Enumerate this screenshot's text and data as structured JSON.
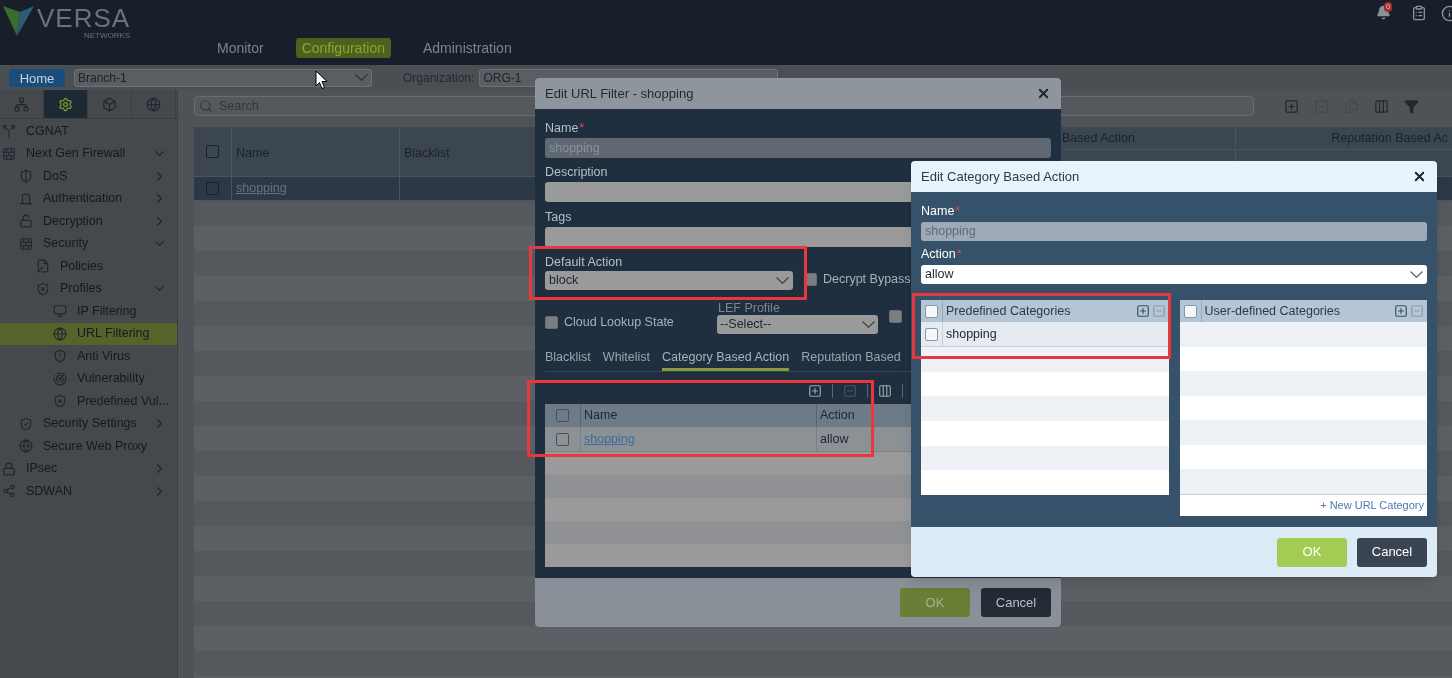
{
  "header": {
    "logo": {
      "name": "VERSA",
      "tagline": "NETWORKS"
    },
    "nav": [
      {
        "label": "Monitor",
        "selected": false
      },
      {
        "label": "Configuration",
        "selected": true
      },
      {
        "label": "Administration",
        "selected": false
      }
    ],
    "notifications": {
      "count": "0"
    }
  },
  "context_bar": {
    "home": "Home",
    "appliance": {
      "value": "Branch-1"
    },
    "organization": {
      "label": "Organization:",
      "value": "ORG-1"
    }
  },
  "sidebar": {
    "tabs": [
      {
        "kind": "network",
        "selected": false
      },
      {
        "kind": "gear",
        "selected": true
      },
      {
        "kind": "cube",
        "selected": false
      },
      {
        "kind": "globe",
        "selected": false
      }
    ],
    "items": [
      {
        "label": "CGNAT",
        "kind": "nat",
        "selected": false
      },
      {
        "label": "Next Gen Firewall",
        "kind": "firewall",
        "selected": false,
        "expanded": true,
        "children": [
          {
            "label": "DoS",
            "kind": "shield",
            "selected": false,
            "expanded": false
          },
          {
            "label": "Authentication",
            "kind": "door",
            "selected": false,
            "expanded": false
          },
          {
            "label": "Decryption",
            "kind": "unlock",
            "selected": false,
            "expanded": false
          },
          {
            "label": "Security",
            "kind": "wall",
            "selected": false,
            "expanded": true,
            "children": [
              {
                "label": "Policies",
                "kind": "doc",
                "selected": false
              },
              {
                "label": "Profiles",
                "kind": "shield-x",
                "selected": false,
                "expanded": true,
                "children": [
                  {
                    "label": "IP Filtering",
                    "kind": "monitor",
                    "selected": false
                  },
                  {
                    "label": "URL Filtering",
                    "kind": "globe",
                    "selected": true
                  },
                  {
                    "label": "Anti Virus",
                    "kind": "shield-alert",
                    "selected": false
                  },
                  {
                    "label": "Vulnerability",
                    "kind": "radar",
                    "selected": false
                  },
                  {
                    "label": "Predefined Vul...",
                    "kind": "shield-x",
                    "selected": false
                  }
                ]
              }
            ]
          },
          {
            "label": "Security Settings",
            "kind": "shield-check",
            "selected": false,
            "expanded": false
          },
          {
            "label": "Secure Web Proxy",
            "kind": "globe",
            "selected": false
          }
        ]
      },
      {
        "label": "IPsec",
        "kind": "lock",
        "selected": false,
        "expanded": false
      },
      {
        "label": "SDWAN",
        "kind": "share",
        "selected": false,
        "expanded": false
      }
    ]
  },
  "main": {
    "search": {
      "placeholder": "Search"
    },
    "table": {
      "columns": [
        "Name",
        "Blacklist"
      ],
      "groups": [
        "Based Action",
        "Reputation Based Ac"
      ],
      "select_all": {
        "checked": false
      },
      "rows": [
        {
          "name": "shopping",
          "selected": true,
          "checked": false
        }
      ]
    }
  },
  "url_filter_dialog": {
    "title": "Edit URL Filter - shopping",
    "name": {
      "label": "Name",
      "required_mark": "*",
      "value": "shopping",
      "disabled": true
    },
    "description": {
      "label": "Description"
    },
    "tags": {
      "label": "Tags"
    },
    "default_action": {
      "label": "Default Action",
      "value": "block"
    },
    "decrypt_bypass": {
      "label": "Decrypt Bypass",
      "checked": false
    },
    "cloud_lookup": {
      "label": "Cloud Lookup State",
      "checked": false
    },
    "lef_profile": {
      "label": "LEF Profile",
      "value": "--Select--"
    },
    "extra_option": {
      "checked": false
    },
    "tabs": [
      {
        "label": "Blacklist",
        "selected": false
      },
      {
        "label": "Whitelist",
        "selected": false
      },
      {
        "label": "Category Based Action",
        "selected": true
      },
      {
        "label": "Reputation Based",
        "selected": false
      }
    ],
    "table": {
      "columns": [
        "Name",
        "Action"
      ],
      "select_all": {
        "checked": false
      },
      "rows": [
        {
          "name": "shopping",
          "action": "allow",
          "checked": false
        }
      ]
    },
    "buttons": [
      {
        "label": "OK",
        "kind": "primary"
      },
      {
        "label": "Cancel",
        "kind": "secondary"
      }
    ]
  },
  "category_dialog": {
    "title": "Edit Category Based Action",
    "name": {
      "label": "Name",
      "required_mark": "*",
      "value": "shopping",
      "disabled": true
    },
    "action": {
      "label": "Action",
      "required_mark": "*",
      "value": "allow"
    },
    "panels": [
      {
        "title": "Predefined Categories",
        "select_all": {
          "checked": false
        },
        "rows": [
          {
            "name": "shopping",
            "checked": false
          }
        ]
      },
      {
        "title": "User-defined Categories",
        "select_all": {
          "checked": false
        },
        "link": "+ New URL Category"
      }
    ],
    "buttons": [
      {
        "label": "OK",
        "kind": "primary"
      },
      {
        "label": "Cancel",
        "kind": "secondary"
      }
    ]
  }
}
